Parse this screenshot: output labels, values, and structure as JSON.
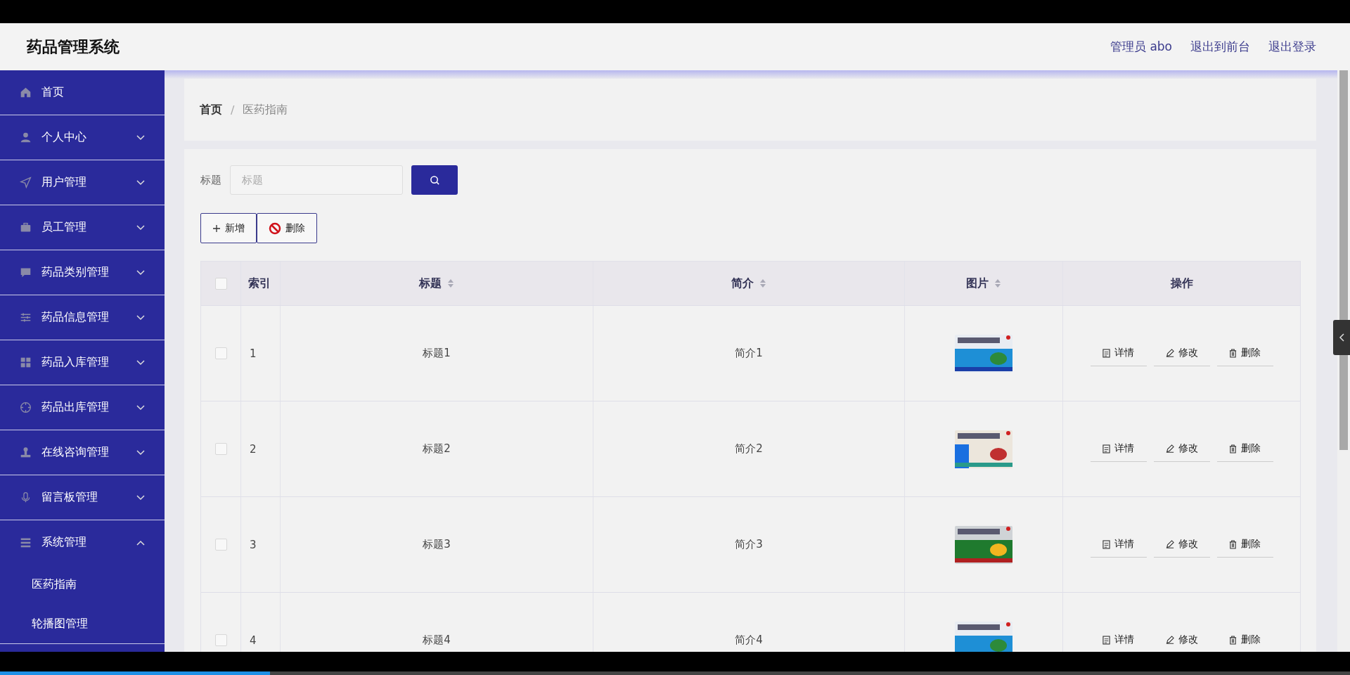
{
  "header": {
    "title": "药品管理系统",
    "links": [
      "管理员 abo",
      "退出到前台",
      "退出登录"
    ]
  },
  "sidebar": {
    "items": [
      {
        "label": "首页"
      },
      {
        "label": "个人中心",
        "expanded": false
      },
      {
        "label": "用户管理",
        "expanded": false
      },
      {
        "label": "员工管理",
        "expanded": false
      },
      {
        "label": "药品类别管理",
        "expanded": false
      },
      {
        "label": "药品信息管理",
        "expanded": false
      },
      {
        "label": "药品入库管理",
        "expanded": false
      },
      {
        "label": "药品出库管理",
        "expanded": false
      },
      {
        "label": "在线咨询管理",
        "expanded": false
      },
      {
        "label": "留言板管理",
        "expanded": false
      },
      {
        "label": "系统管理",
        "expanded": true,
        "children": [
          {
            "label": "医药指南"
          },
          {
            "label": "轮播图管理"
          }
        ]
      }
    ]
  },
  "breadcrumb": {
    "items": [
      "首页",
      "医药指南"
    ],
    "separator": "/"
  },
  "search": {
    "label": "标题",
    "placeholder": "标题"
  },
  "actions": [
    "新增",
    "删除"
  ],
  "table": {
    "columns": [
      {
        "label": "索引",
        "sortable": false
      },
      {
        "label": "标题",
        "sortable": true
      },
      {
        "label": "简介",
        "sortable": true
      },
      {
        "label": "图片",
        "sortable": true
      },
      {
        "label": "操作",
        "sortable": false
      }
    ],
    "header_checked": false,
    "rows": [
      {
        "checked": false,
        "index": "1",
        "title": "标题1",
        "intro": "简介1",
        "picture": {
          "kind": "picture"
        },
        "actions": [
          "详情",
          "修改",
          "删除"
        ]
      },
      {
        "checked": false,
        "index": "2",
        "title": "标题2",
        "intro": "简介2",
        "picture": {
          "kind": "picture"
        },
        "actions": [
          "详情",
          "修改",
          "删除"
        ]
      },
      {
        "checked": false,
        "index": "3",
        "title": "标题3",
        "intro": "简介3",
        "picture": {
          "kind": "picture"
        },
        "actions": [
          "详情",
          "修改",
          "删除"
        ]
      },
      {
        "checked": false,
        "index": "4",
        "title": "标题4",
        "intro": "简介4",
        "picture": {
          "kind": "picture"
        },
        "actions": [
          "详情",
          "修改",
          "删除"
        ]
      }
    ]
  },
  "player": {
    "level": 0.2
  }
}
